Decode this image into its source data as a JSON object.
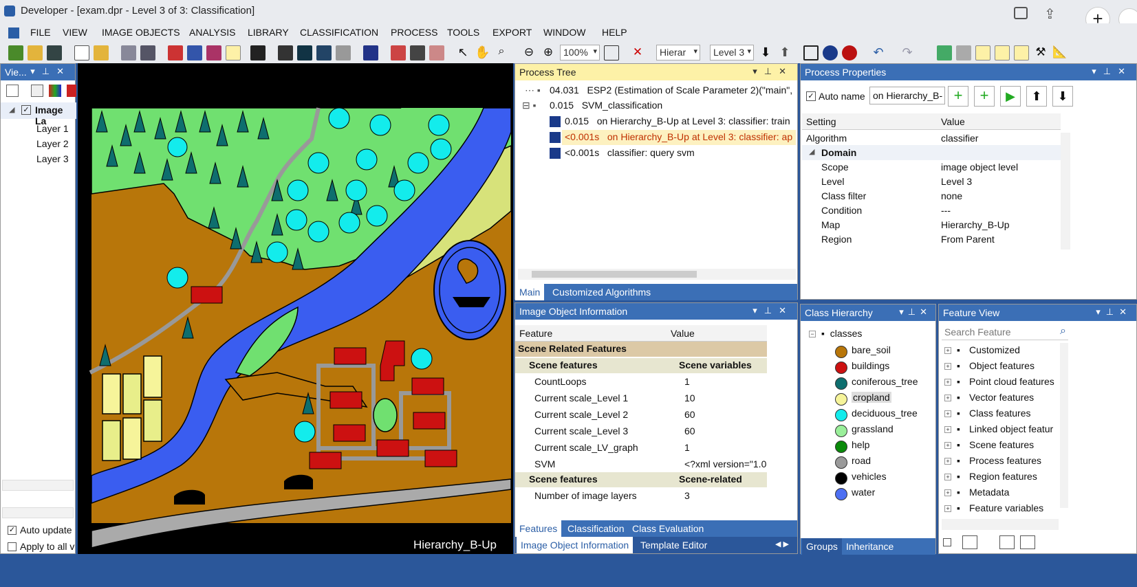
{
  "window": {
    "title": "Developer - [exam.dpr - Level 3 of 3: Classification]"
  },
  "menu": [
    "FILE",
    "VIEW",
    "IMAGE OBJECTS",
    "ANALYSIS",
    "LIBRARY",
    "CLASSIFICATION",
    "PROCESS",
    "TOOLS",
    "EXPORT",
    "WINDOW",
    "HELP"
  ],
  "toolbar": {
    "zoom": "100%",
    "hierarchy": "Hierar",
    "level": "Level 3"
  },
  "viewer_panel": {
    "title": "Vie...",
    "root": "Image La",
    "layers": [
      "Layer 1",
      "Layer 2",
      "Layer 3"
    ],
    "auto_update": "Auto update",
    "apply_all": "Apply to all v"
  },
  "image_view": {
    "label": "Hierarchy_B-Up"
  },
  "process_tree": {
    "title": "Process Tree",
    "rows": [
      {
        "time": "04.031",
        "text": "ESP2 (Estimation of Scale Parameter 2)(\"main\","
      },
      {
        "time": "0.015",
        "text": "SVM_classification"
      },
      {
        "time": "0.015",
        "text": "on Hierarchy_B-Up at  Level 3: classifier: train"
      },
      {
        "time": "<0.001s",
        "text": "on Hierarchy_B-Up at  Level 3: classifier: ap"
      },
      {
        "time": "<0.001s",
        "text": "classifier: query svm"
      }
    ],
    "tabs": [
      "Main",
      "Customized Algorithms"
    ]
  },
  "process_properties": {
    "title": "Process Properties",
    "auto_name": "Auto name",
    "name_value": "on Hierarchy_B-",
    "col_setting": "Setting",
    "col_value": "Value",
    "rows": [
      {
        "k": "Algorithm",
        "v": "classifier"
      },
      {
        "k": "Domain",
        "v": ""
      },
      {
        "k": "Scope",
        "v": "image object level"
      },
      {
        "k": "Level",
        "v": "Level 3"
      },
      {
        "k": "Class filter",
        "v": "none"
      },
      {
        "k": "Condition",
        "v": "---"
      },
      {
        "k": "Map",
        "v": "Hierarchy_B-Up"
      },
      {
        "k": "Region",
        "v": "From Parent"
      }
    ]
  },
  "image_object_info": {
    "title": "Image Object Information",
    "col_feature": "Feature",
    "col_value": "Value",
    "group": "Scene Related Features",
    "sub1": {
      "k": "Scene features",
      "v": "Scene variables"
    },
    "rows": [
      {
        "k": "CountLoops",
        "v": "1"
      },
      {
        "k": "Current scale_Level 1",
        "v": "10"
      },
      {
        "k": "Current scale_Level 2",
        "v": "60"
      },
      {
        "k": "Current scale_Level 3",
        "v": "60"
      },
      {
        "k": "Current scale_LV_graph",
        "v": "1"
      },
      {
        "k": "SVM",
        "v": "<?xml version=\"1.0"
      }
    ],
    "sub2": {
      "k": "Scene features",
      "v": "Scene-related"
    },
    "row_last": {
      "k": "Number of image layers",
      "v": "3"
    },
    "tabs": [
      "Features",
      "Classification",
      "Class Evaluation"
    ],
    "bottom_tabs": [
      "Image Object Information",
      "Template Editor"
    ]
  },
  "class_hierarchy": {
    "title": "Class Hierarchy",
    "root": "classes",
    "classes": [
      {
        "name": "bare_soil",
        "color": "#b8760a"
      },
      {
        "name": "buildings",
        "color": "#cc1111"
      },
      {
        "name": "coniferous_tree",
        "color": "#0e6e6e"
      },
      {
        "name": "cropland",
        "color": "#f6f49a"
      },
      {
        "name": "deciduous_tree",
        "color": "#13ecec"
      },
      {
        "name": "grassland",
        "color": "#9aef9a"
      },
      {
        "name": "help",
        "color": "#0a8a0a"
      },
      {
        "name": "road",
        "color": "#9a9a9a"
      },
      {
        "name": "vehicles",
        "color": "#000000"
      },
      {
        "name": "water",
        "color": "#4d6ff2"
      }
    ],
    "tabs": [
      "Groups",
      "Inheritance"
    ]
  },
  "feature_view": {
    "title": "Feature View",
    "search_placeholder": "Search Feature",
    "items": [
      "Customized",
      "Object features",
      "Point cloud features",
      "Vector features",
      "Class features",
      "Linked object featur",
      "Scene features",
      "Process features",
      "Region features",
      "Metadata",
      "Feature variables"
    ]
  }
}
